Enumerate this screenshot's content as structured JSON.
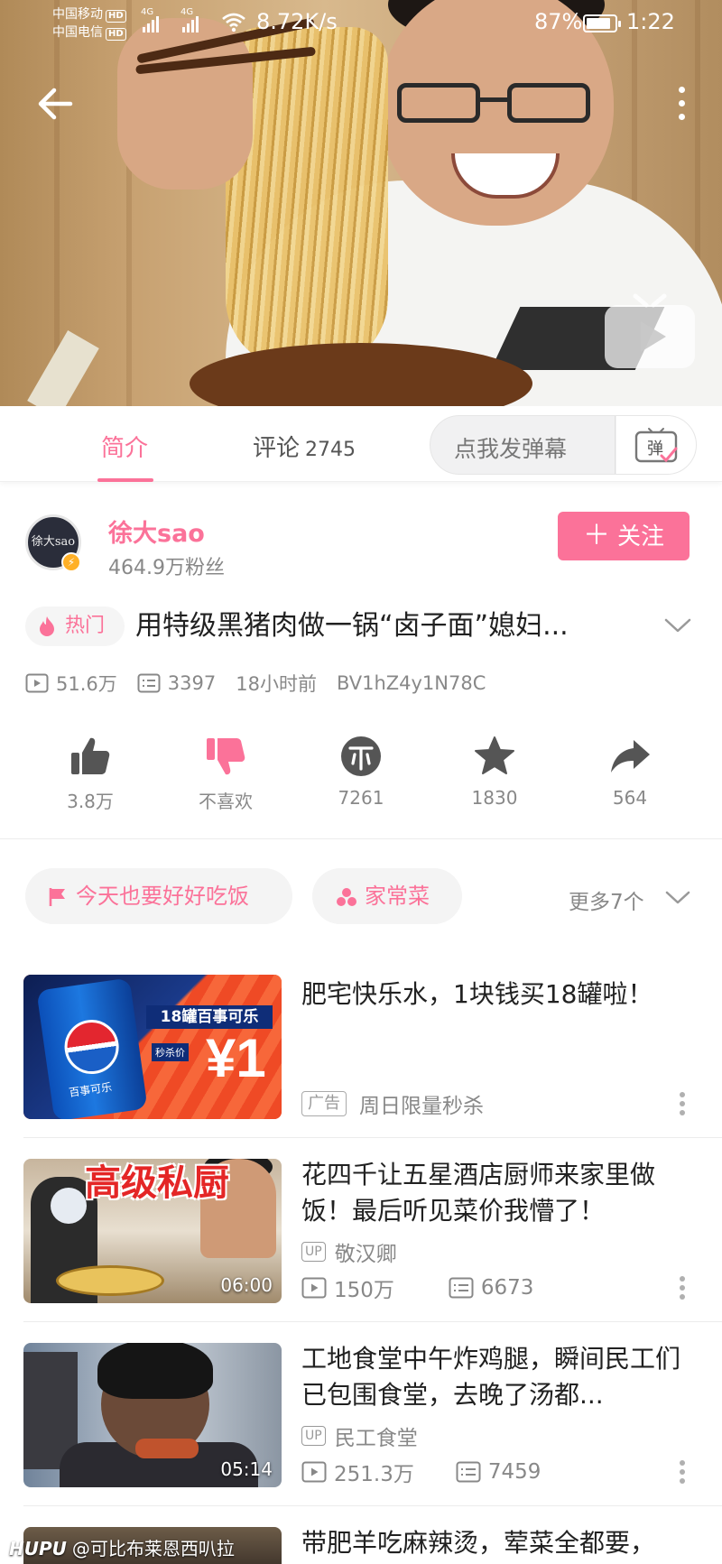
{
  "status_bar": {
    "carrier_1": "中国移动",
    "carrier_2": "中国电信",
    "hd_badge": "HD",
    "network_type": "4G",
    "net_speed": "8.72K/s",
    "battery_percent": "87%",
    "battery_level": 0.87,
    "time": "1:22"
  },
  "player": {
    "back_icon": "arrow-left-icon",
    "more_icon": "more-vertical-icon",
    "play_icon": "tv-play-icon"
  },
  "tabs": {
    "intro_label": "简介",
    "comments_label": "评论",
    "comments_count": "2745",
    "active": "intro"
  },
  "danmaku": {
    "placeholder": "点我发弹幕",
    "toggle_label": "弹"
  },
  "uploader": {
    "avatar_text": "徐大sao",
    "name": "徐大sao",
    "fans": "464.9万粉丝",
    "follow_label": "关注",
    "follow_icon": "plus-icon"
  },
  "video": {
    "hot_badge": "热门",
    "title": "用特级黑猪肉做一锅“卤子面”媳妇...",
    "views": "51.6万",
    "danmaku_count": "3397",
    "published": "18小时前",
    "bvid": "BV1hZ4y1N78C"
  },
  "actions": [
    {
      "icon": "thumbs-up-icon",
      "label": "3.8万"
    },
    {
      "icon": "thumbs-down-icon",
      "label": "不喜欢"
    },
    {
      "icon": "coin-icon",
      "label": "7261"
    },
    {
      "icon": "star-icon",
      "label": "1830"
    },
    {
      "icon": "share-icon",
      "label": "564"
    }
  ],
  "tags": {
    "chip_1": "今天也要好好吃饭",
    "chip_2": "家常菜",
    "more": "更多7个"
  },
  "related": [
    {
      "title": "肥宅快乐水，1块钱买18罐啦！",
      "ad_label": "广告",
      "subtitle": "周日限量秒杀",
      "thumb_banner": "18罐百事可乐",
      "thumb_price_tag": "秒杀价",
      "thumb_price": "¥1",
      "thumb_can_text": "百事可乐"
    },
    {
      "title": "花四千让五星酒店厨师来家里做饭！最后听见菜价我懵了！",
      "up_tag": "UP",
      "uploader": "敬汉卿",
      "views": "150万",
      "danmaku": "6673",
      "duration": "06:00",
      "thumb_text": "高级私厨"
    },
    {
      "title": "工地食堂中午炸鸡腿，瞬间民工们已包围食堂，去晚了汤都...",
      "up_tag": "UP",
      "uploader": "民工食堂",
      "views": "251.3万",
      "danmaku": "7459",
      "duration": "05:14"
    },
    {
      "title": "带肥羊吃麻辣烫，荤菜全都要，"
    }
  ],
  "watermark": {
    "brand": "HUPU",
    "handle": "@可比布莱恩西叭拉"
  },
  "colors": {
    "accent": "#fb7299",
    "text_primary": "#212121",
    "text_secondary": "#888888"
  }
}
